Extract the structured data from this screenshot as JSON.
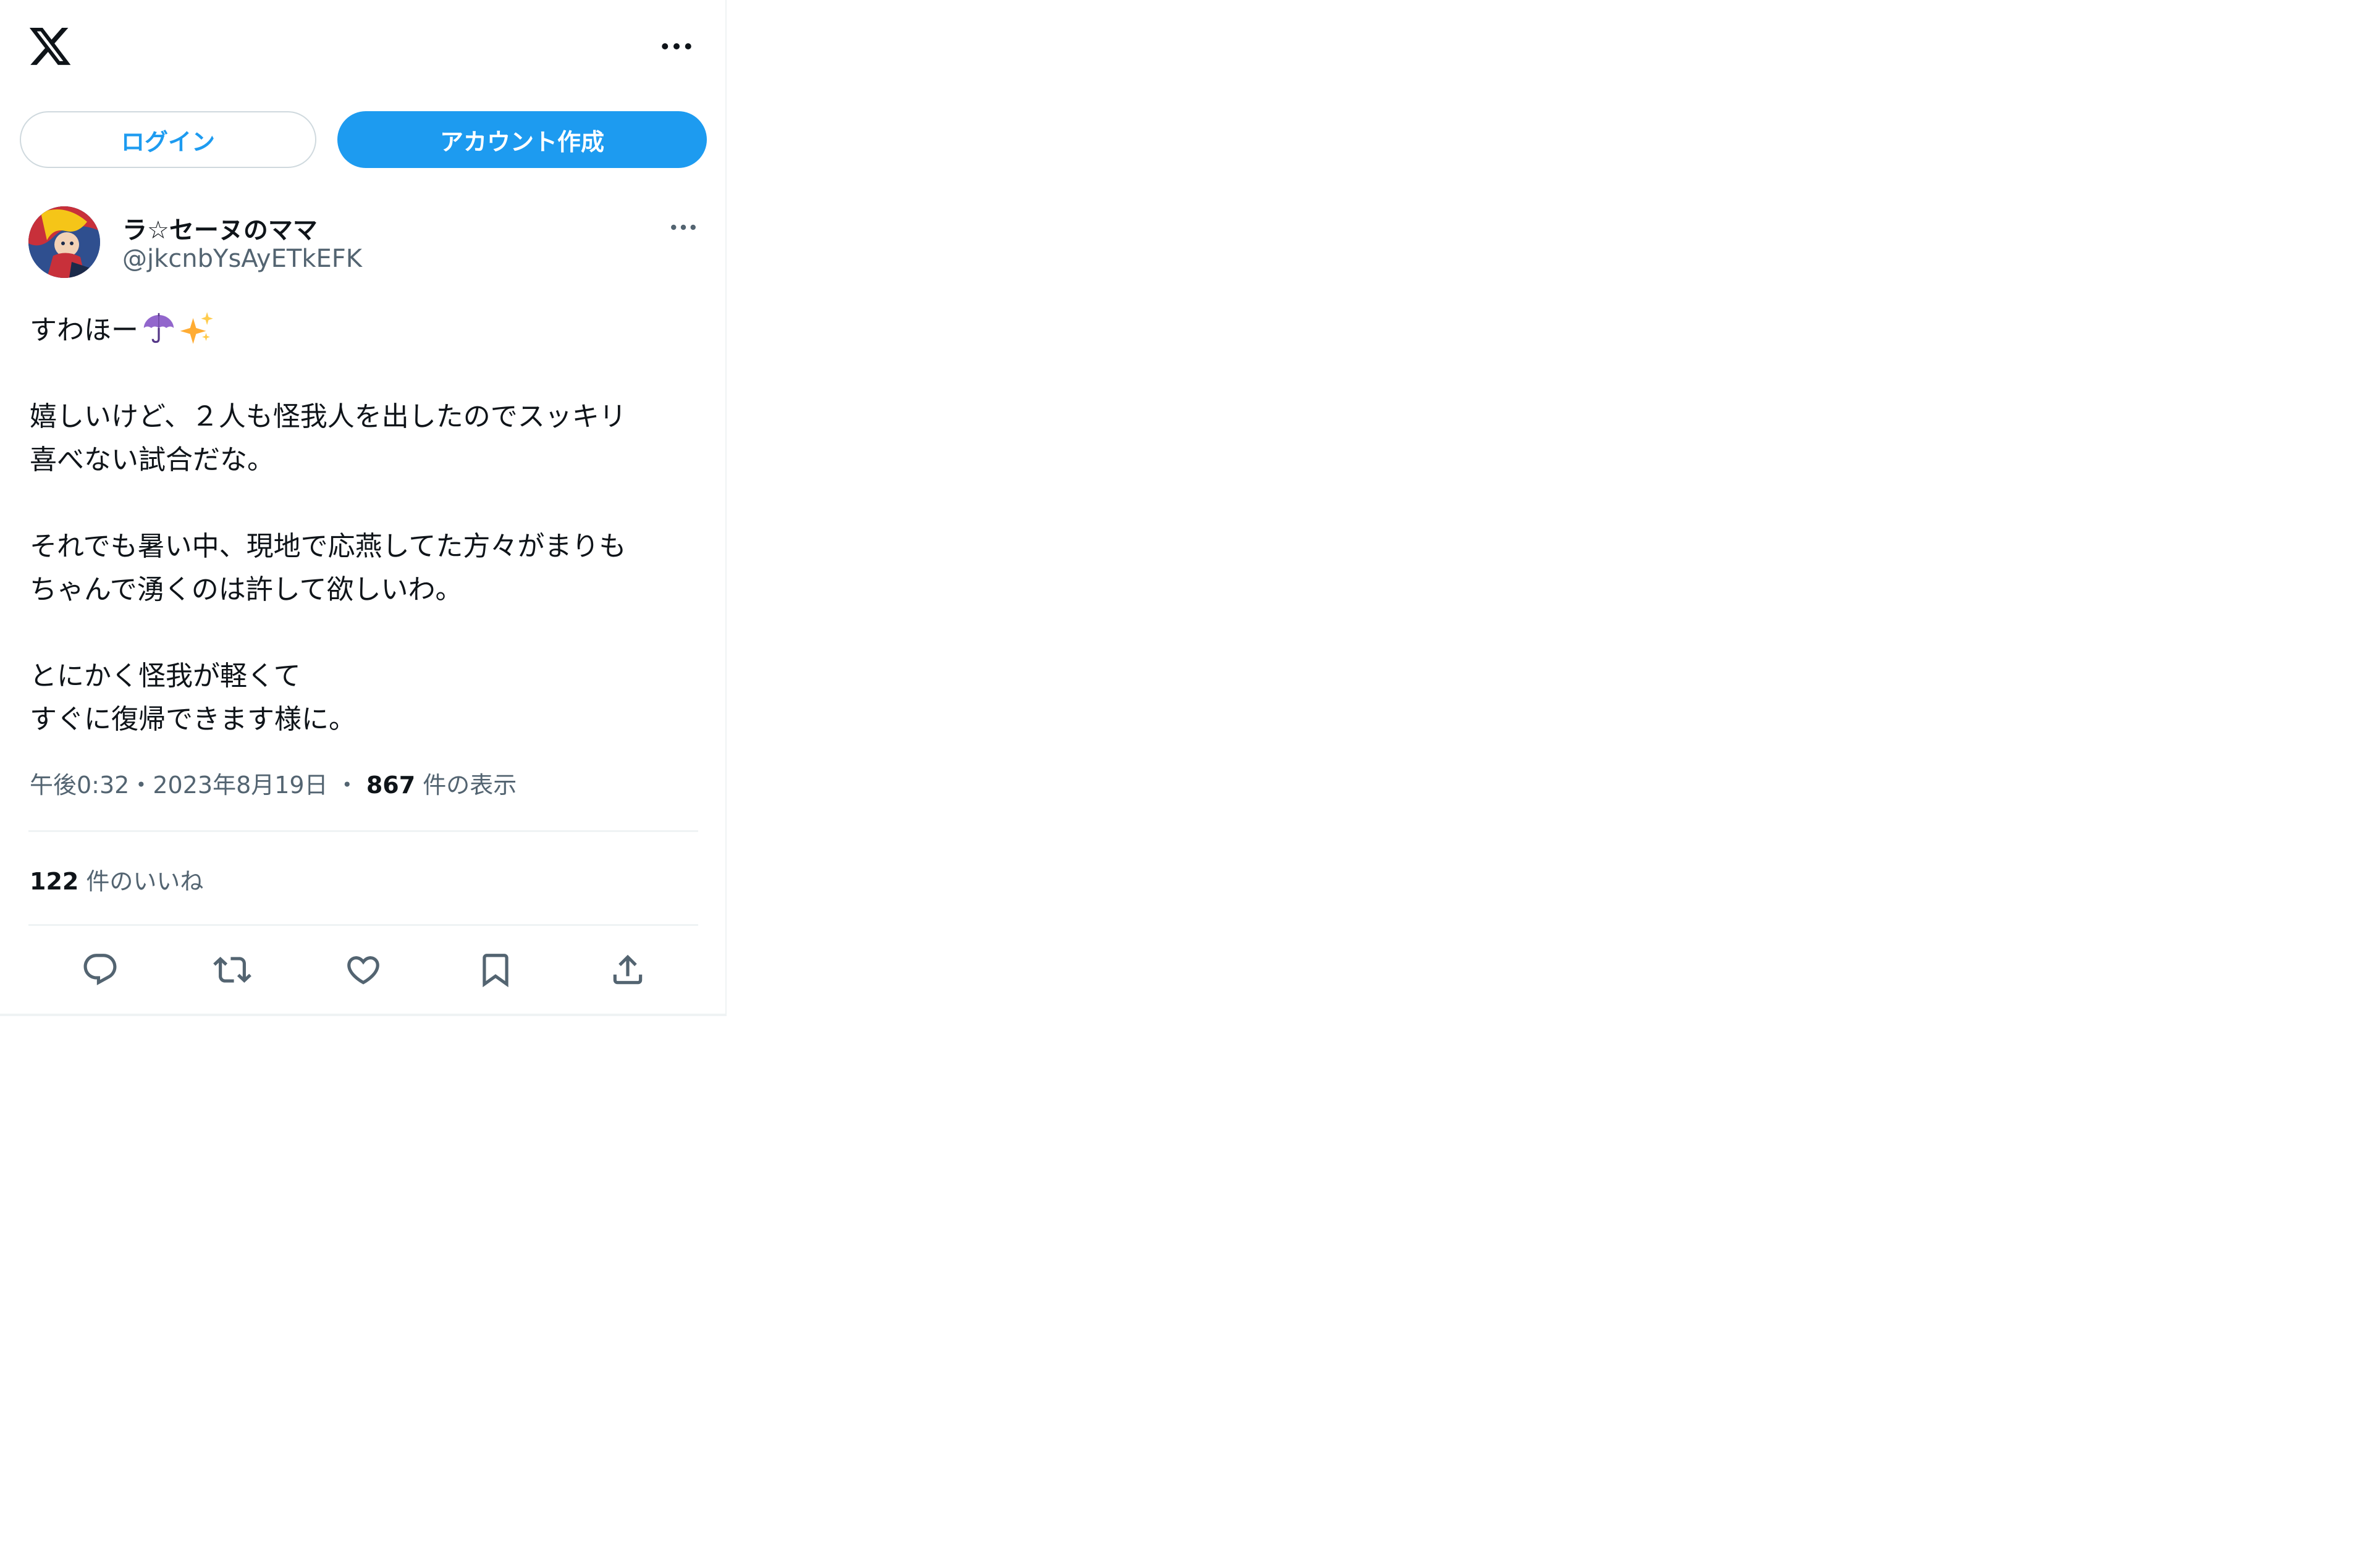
{
  "topbar": {
    "logo_icon": "x-logo-icon",
    "more_icon": "more-horizontal-icon"
  },
  "auth": {
    "login_label": "ログイン",
    "signup_label": "アカウント作成"
  },
  "tweet": {
    "author": {
      "display_name": "ラ☆セーヌのママ",
      "handle": "@jkcnbYsAyETkEFK"
    },
    "text_lines": [
      "すわほー",
      "",
      "嬉しいけど、２人も怪我人を出したのでスッキリ",
      "喜べない試合だな。",
      "",
      "それでも暑い中、現地で応燕してた方々がまりも",
      "ちゃんで湧くのは許して欲しいわ。",
      "",
      "とにかく怪我が軽くて",
      "すぐに復帰できます様に。"
    ],
    "emojis": [
      "umbrella-icon",
      "sparkles-icon"
    ],
    "time": "午後0:32",
    "separator": "・",
    "date": "2023年8月19日",
    "separator2": "・",
    "views_count": "867",
    "views_label": "件の表示",
    "likes_count": "122",
    "likes_label": "件のいいね"
  },
  "actions": [
    "reply-icon",
    "retweet-icon",
    "like-icon",
    "bookmark-icon",
    "share-icon"
  ],
  "colors": {
    "accent": "#1d9bf0",
    "text": "#0f1419",
    "secondary": "#536471",
    "divider": "#eff3f4"
  }
}
